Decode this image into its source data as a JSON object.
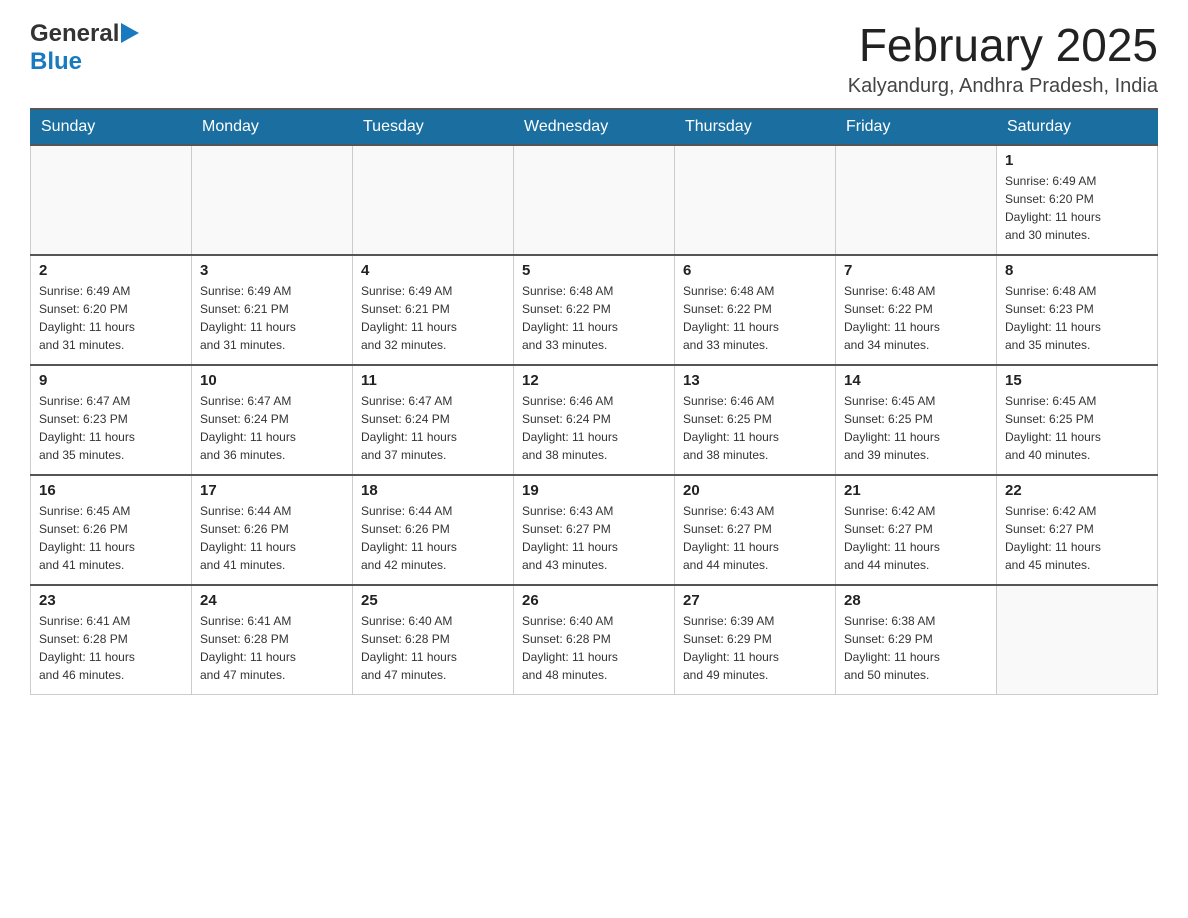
{
  "header": {
    "logo": {
      "general": "General",
      "blue": "Blue",
      "arrow": "▶"
    },
    "title": "February 2025",
    "location": "Kalyandurg, Andhra Pradesh, India"
  },
  "weekdays": [
    "Sunday",
    "Monday",
    "Tuesday",
    "Wednesday",
    "Thursday",
    "Friday",
    "Saturday"
  ],
  "weeks": [
    [
      {
        "day": "",
        "info": ""
      },
      {
        "day": "",
        "info": ""
      },
      {
        "day": "",
        "info": ""
      },
      {
        "day": "",
        "info": ""
      },
      {
        "day": "",
        "info": ""
      },
      {
        "day": "",
        "info": ""
      },
      {
        "day": "1",
        "info": "Sunrise: 6:49 AM\nSunset: 6:20 PM\nDaylight: 11 hours\nand 30 minutes."
      }
    ],
    [
      {
        "day": "2",
        "info": "Sunrise: 6:49 AM\nSunset: 6:20 PM\nDaylight: 11 hours\nand 31 minutes."
      },
      {
        "day": "3",
        "info": "Sunrise: 6:49 AM\nSunset: 6:21 PM\nDaylight: 11 hours\nand 31 minutes."
      },
      {
        "day": "4",
        "info": "Sunrise: 6:49 AM\nSunset: 6:21 PM\nDaylight: 11 hours\nand 32 minutes."
      },
      {
        "day": "5",
        "info": "Sunrise: 6:48 AM\nSunset: 6:22 PM\nDaylight: 11 hours\nand 33 minutes."
      },
      {
        "day": "6",
        "info": "Sunrise: 6:48 AM\nSunset: 6:22 PM\nDaylight: 11 hours\nand 33 minutes."
      },
      {
        "day": "7",
        "info": "Sunrise: 6:48 AM\nSunset: 6:22 PM\nDaylight: 11 hours\nand 34 minutes."
      },
      {
        "day": "8",
        "info": "Sunrise: 6:48 AM\nSunset: 6:23 PM\nDaylight: 11 hours\nand 35 minutes."
      }
    ],
    [
      {
        "day": "9",
        "info": "Sunrise: 6:47 AM\nSunset: 6:23 PM\nDaylight: 11 hours\nand 35 minutes."
      },
      {
        "day": "10",
        "info": "Sunrise: 6:47 AM\nSunset: 6:24 PM\nDaylight: 11 hours\nand 36 minutes."
      },
      {
        "day": "11",
        "info": "Sunrise: 6:47 AM\nSunset: 6:24 PM\nDaylight: 11 hours\nand 37 minutes."
      },
      {
        "day": "12",
        "info": "Sunrise: 6:46 AM\nSunset: 6:24 PM\nDaylight: 11 hours\nand 38 minutes."
      },
      {
        "day": "13",
        "info": "Sunrise: 6:46 AM\nSunset: 6:25 PM\nDaylight: 11 hours\nand 38 minutes."
      },
      {
        "day": "14",
        "info": "Sunrise: 6:45 AM\nSunset: 6:25 PM\nDaylight: 11 hours\nand 39 minutes."
      },
      {
        "day": "15",
        "info": "Sunrise: 6:45 AM\nSunset: 6:25 PM\nDaylight: 11 hours\nand 40 minutes."
      }
    ],
    [
      {
        "day": "16",
        "info": "Sunrise: 6:45 AM\nSunset: 6:26 PM\nDaylight: 11 hours\nand 41 minutes."
      },
      {
        "day": "17",
        "info": "Sunrise: 6:44 AM\nSunset: 6:26 PM\nDaylight: 11 hours\nand 41 minutes."
      },
      {
        "day": "18",
        "info": "Sunrise: 6:44 AM\nSunset: 6:26 PM\nDaylight: 11 hours\nand 42 minutes."
      },
      {
        "day": "19",
        "info": "Sunrise: 6:43 AM\nSunset: 6:27 PM\nDaylight: 11 hours\nand 43 minutes."
      },
      {
        "day": "20",
        "info": "Sunrise: 6:43 AM\nSunset: 6:27 PM\nDaylight: 11 hours\nand 44 minutes."
      },
      {
        "day": "21",
        "info": "Sunrise: 6:42 AM\nSunset: 6:27 PM\nDaylight: 11 hours\nand 44 minutes."
      },
      {
        "day": "22",
        "info": "Sunrise: 6:42 AM\nSunset: 6:27 PM\nDaylight: 11 hours\nand 45 minutes."
      }
    ],
    [
      {
        "day": "23",
        "info": "Sunrise: 6:41 AM\nSunset: 6:28 PM\nDaylight: 11 hours\nand 46 minutes."
      },
      {
        "day": "24",
        "info": "Sunrise: 6:41 AM\nSunset: 6:28 PM\nDaylight: 11 hours\nand 47 minutes."
      },
      {
        "day": "25",
        "info": "Sunrise: 6:40 AM\nSunset: 6:28 PM\nDaylight: 11 hours\nand 47 minutes."
      },
      {
        "day": "26",
        "info": "Sunrise: 6:40 AM\nSunset: 6:28 PM\nDaylight: 11 hours\nand 48 minutes."
      },
      {
        "day": "27",
        "info": "Sunrise: 6:39 AM\nSunset: 6:29 PM\nDaylight: 11 hours\nand 49 minutes."
      },
      {
        "day": "28",
        "info": "Sunrise: 6:38 AM\nSunset: 6:29 PM\nDaylight: 11 hours\nand 50 minutes."
      },
      {
        "day": "",
        "info": ""
      }
    ]
  ]
}
